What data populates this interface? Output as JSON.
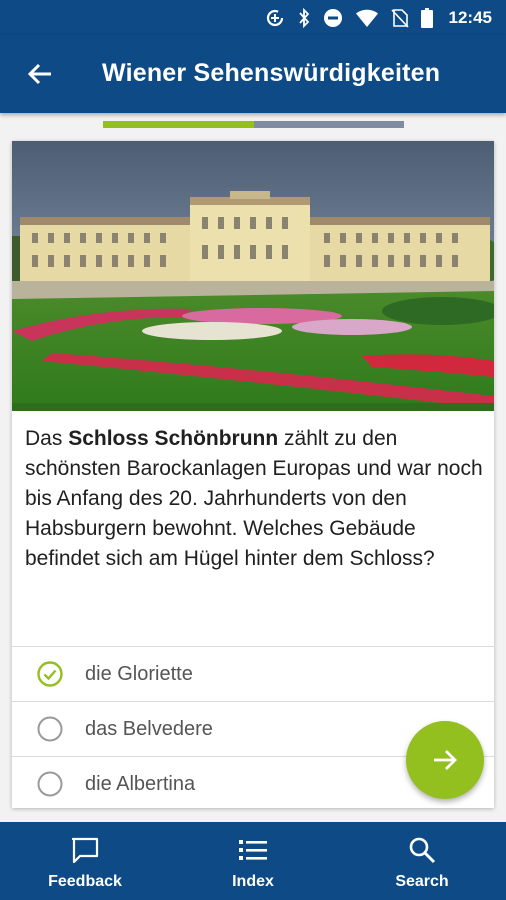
{
  "status_bar": {
    "time": "12:45",
    "icons": [
      "data-saver-icon",
      "bluetooth-icon",
      "do-not-disturb-icon",
      "wifi-icon",
      "no-sim-icon",
      "battery-icon"
    ]
  },
  "app_bar": {
    "title": "Wiener Sehenswürdigkeiten",
    "back_icon": "arrow-back-icon"
  },
  "progress": {
    "fraction": 0.5
  },
  "question": {
    "image": "schloss-schoenbrunn-photo",
    "text_before": "Das ",
    "text_bold": "Schloss Schönbrunn",
    "text_after": " zählt zu den schönsten Barockanlagen Europas und war noch bis Anfang des 20. Jahrhunderts von den Habsburgern bewohnt. Welches Gebäude befindet sich am Hügel hinter dem Schloss?"
  },
  "answers": [
    {
      "label": "die Gloriette",
      "state": "correct",
      "icon": "check-circle-icon"
    },
    {
      "label": "das Belvedere",
      "state": "unselected",
      "icon": "radio-empty-icon"
    },
    {
      "label": "die Albertina",
      "state": "unselected",
      "icon": "radio-empty-icon"
    }
  ],
  "fab": {
    "icon": "arrow-forward-icon"
  },
  "bottom_nav": [
    {
      "label": "Feedback",
      "icon": "feedback-icon"
    },
    {
      "label": "Index",
      "icon": "list-icon"
    },
    {
      "label": "Search",
      "icon": "search-icon"
    }
  ],
  "colors": {
    "primary": "#0d4a86",
    "accent": "#93c01f",
    "progress_track": "#7f8ba0",
    "background": "#f2f2f2"
  }
}
